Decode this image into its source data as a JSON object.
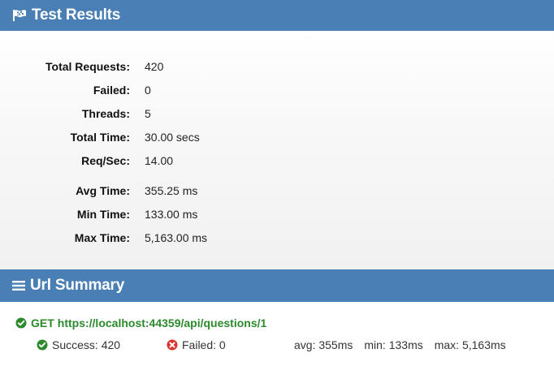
{
  "results": {
    "title": "Test Results",
    "icon": "flag-icon",
    "stats": [
      {
        "label": "Total Requests:",
        "value": "420"
      },
      {
        "label": "Failed:",
        "value": "0"
      },
      {
        "label": "Threads:",
        "value": "5"
      },
      {
        "label": "Total Time:",
        "value": "30.00 secs"
      },
      {
        "label": "Req/Sec:",
        "value": "14.00"
      },
      {
        "label": "Avg Time:",
        "value": "355.25 ms"
      },
      {
        "label": "Min Time:",
        "value": "133.00 ms"
      },
      {
        "label": "Max Time:",
        "value": "5,163.00 ms"
      }
    ]
  },
  "url_summary": {
    "title": "Url Summary",
    "icon": "list-icon",
    "entry": {
      "status_icon": "check-circle-icon",
      "method": "GET",
      "url": "https://localhost:44359/api/questions/1",
      "success": "Success: 420",
      "failed": "Failed: 0",
      "avg": "avg: 355ms",
      "min": "min: 133ms",
      "max": "max: 5,163ms"
    }
  },
  "colors": {
    "header_bg": "#4a7fb5",
    "success_green": "#2b8a2b",
    "failed_red": "#d9342b"
  }
}
